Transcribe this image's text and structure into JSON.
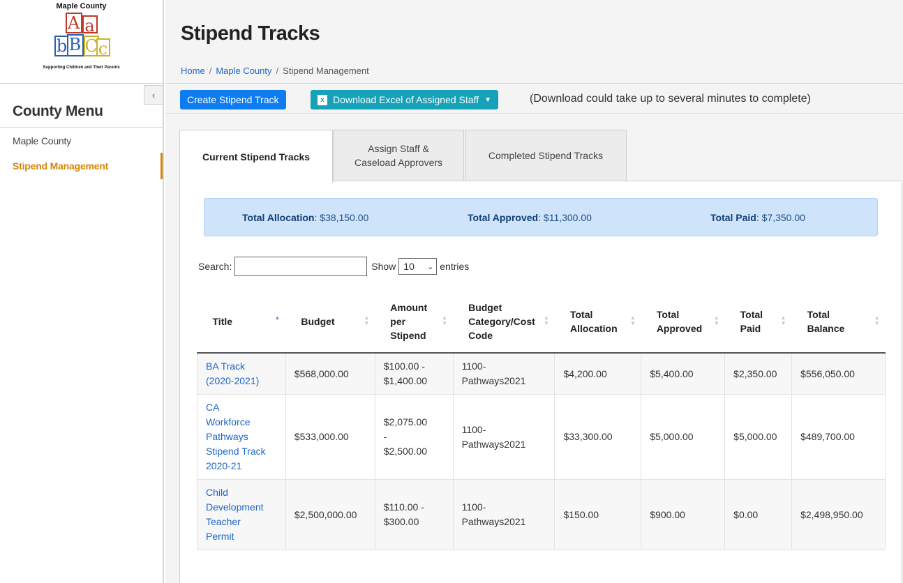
{
  "logo": {
    "title": "Maple County",
    "tagline": "Supporting Children and Their Parents",
    "blocks": [
      "A",
      "a",
      "b",
      "B",
      "C",
      "c"
    ]
  },
  "sidebar": {
    "heading": "County Menu",
    "collapse_glyph": "‹",
    "items": [
      {
        "label": "Maple County"
      },
      {
        "label": "Stipend Management"
      }
    ]
  },
  "header": {
    "title": "Stipend Tracks",
    "breadcrumb": [
      {
        "label": "Home"
      },
      {
        "label": "Maple County"
      },
      {
        "label": "Stipend Management"
      }
    ],
    "separator": "/"
  },
  "toolbar": {
    "create_label": "Create Stipend Track",
    "download_label": "Download Excel of Assigned Staff",
    "download_note": "(Download could take up to several minutes to complete)"
  },
  "tabs": [
    {
      "label": "Current Stipend Tracks"
    },
    {
      "label_line1": "Assign Staff &",
      "label_line2": "Caseload Approvers"
    },
    {
      "label": "Completed Stipend Tracks"
    }
  ],
  "totals": {
    "allocation_label": "Total Allocation",
    "allocation_value": ": $38,150.00",
    "approved_label": "Total Approved",
    "approved_value": ": $11,300.00",
    "paid_label": "Total Paid",
    "paid_value": ": $7,350.00"
  },
  "table_controls": {
    "search_label": "Search:",
    "search_value": "",
    "show_label": "Show",
    "show_value": "10",
    "entries_label": "entries"
  },
  "table": {
    "columns": [
      {
        "l1": "Title",
        "l2": "",
        "l3": ""
      },
      {
        "l1": "Budget",
        "l2": "",
        "l3": ""
      },
      {
        "l1": "Amount",
        "l2": "per",
        "l3": "Stipend"
      },
      {
        "l1": "Budget",
        "l2": "Category/Cost",
        "l3": "Code"
      },
      {
        "l1": "Total",
        "l2": "Allocation",
        "l3": ""
      },
      {
        "l1": "Total",
        "l2": "Approved",
        "l3": ""
      },
      {
        "l1": "Total",
        "l2": "Paid",
        "l3": ""
      },
      {
        "l1": "Total",
        "l2": "Balance",
        "l3": ""
      }
    ],
    "rows": [
      {
        "title": [
          "BA Track",
          "(2020-2021)"
        ],
        "budget": "$568,000.00",
        "amount": [
          "$100.00 -",
          "$1,400.00"
        ],
        "code": [
          "1100-",
          "Pathways2021"
        ],
        "allocation": "$4,200.00",
        "approved": "$5,400.00",
        "paid": "$2,350.00",
        "balance": "$556,050.00"
      },
      {
        "title": [
          "CA",
          "Workforce",
          "Pathways",
          "Stipend Track",
          "2020-21"
        ],
        "budget": "$533,000.00",
        "amount": [
          "$2,075.00",
          "-",
          "$2,500.00"
        ],
        "code": [
          "1100-",
          "Pathways2021"
        ],
        "allocation": "$33,300.00",
        "approved": "$5,000.00",
        "paid": "$5,000.00",
        "balance": "$489,700.00"
      },
      {
        "title": [
          "Child",
          "Development",
          "Teacher",
          "Permit"
        ],
        "budget": "$2,500,000.00",
        "amount": [
          "$110.00 -",
          "$300.00"
        ],
        "code": [
          "1100-",
          "Pathways2021"
        ],
        "allocation": "$150.00",
        "approved": "$900.00",
        "paid": "$0.00",
        "balance": "$2,498,950.00"
      }
    ]
  },
  "colors": {
    "primary": "#0d7cf0",
    "info": "#15a2b8",
    "accent": "#d4860b",
    "link": "#1a66c7"
  }
}
